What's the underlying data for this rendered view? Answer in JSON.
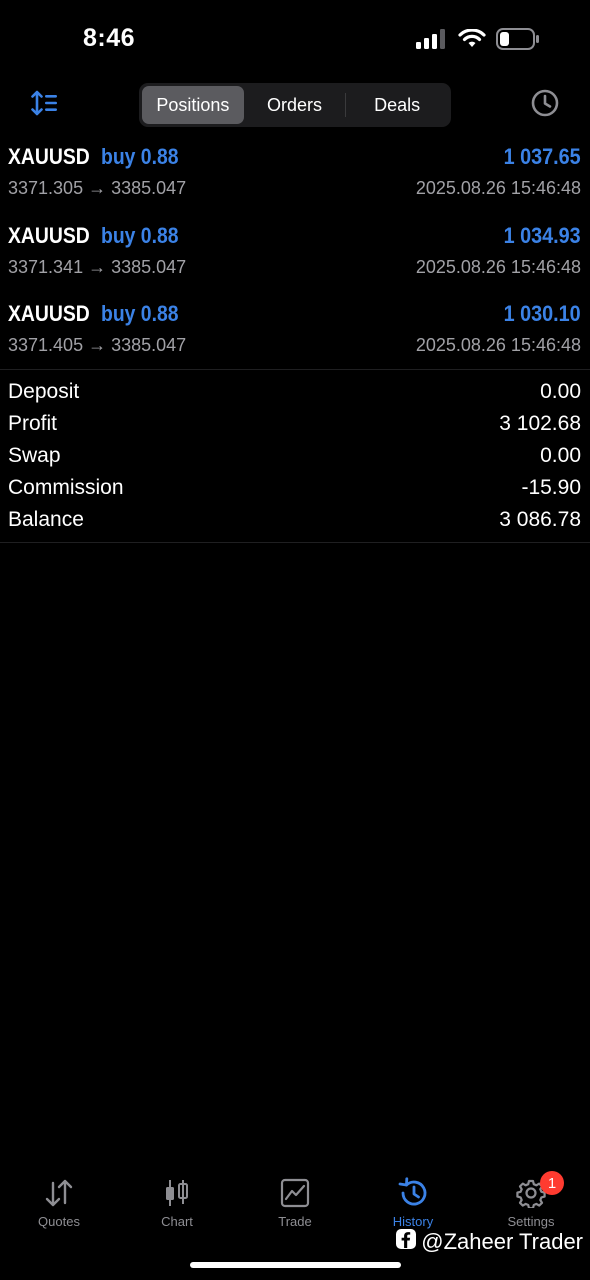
{
  "status": {
    "time": "8:46"
  },
  "header": {
    "tabs": [
      {
        "label": "Positions",
        "active": true
      },
      {
        "label": "Orders",
        "active": false
      },
      {
        "label": "Deals",
        "active": false
      }
    ]
  },
  "positions": [
    {
      "symbol": "XAUUSD",
      "side": "buy 0.88",
      "profit": "1 037.65",
      "prices": "3371.305 → 3385.047",
      "time": "2025.08.26 15:46:48"
    },
    {
      "symbol": "XAUUSD",
      "side": "buy 0.88",
      "profit": "1 034.93",
      "prices": "3371.341 → 3385.047",
      "time": "2025.08.26 15:46:48"
    },
    {
      "symbol": "XAUUSD",
      "side": "buy 0.88",
      "profit": "1 030.10",
      "prices": "3371.405 → 3385.047",
      "time": "2025.08.26 15:46:48"
    }
  ],
  "summary": [
    {
      "label": "Deposit",
      "value": "0.00"
    },
    {
      "label": "Profit",
      "value": "3 102.68"
    },
    {
      "label": "Swap",
      "value": "0.00"
    },
    {
      "label": "Commission",
      "value": "-15.90"
    },
    {
      "label": "Balance",
      "value": "3 086.78"
    }
  ],
  "tabbar": {
    "items": [
      {
        "label": "Quotes",
        "icon": "quotes-arrows-icon"
      },
      {
        "label": "Chart",
        "icon": "candlestick-chart-icon"
      },
      {
        "label": "Trade",
        "icon": "trade-line-chart-icon"
      },
      {
        "label": "History",
        "icon": "history-clock-icon",
        "active": true
      },
      {
        "label": "Settings",
        "icon": "gear-icon",
        "badge": "1"
      }
    ]
  },
  "watermark": "@Zaheer Trader",
  "colors": {
    "accent": "#3b82e6",
    "secondary_text": "#a1a1a6",
    "background": "#000000",
    "badge": "#ff3b30"
  }
}
